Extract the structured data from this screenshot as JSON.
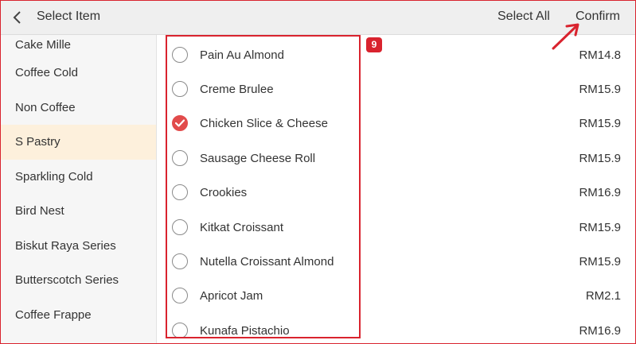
{
  "header": {
    "title": "Select Item",
    "select_all_label": "Select All",
    "confirm_label": "Confirm",
    "back_icon": "chevron-left-icon"
  },
  "sidebar": {
    "items": [
      {
        "label": "Cake Mille",
        "active": false
      },
      {
        "label": "Coffee Cold",
        "active": false
      },
      {
        "label": "Non Coffee",
        "active": false
      },
      {
        "label": "S Pastry",
        "active": true
      },
      {
        "label": "Sparkling Cold",
        "active": false
      },
      {
        "label": "Bird Nest",
        "active": false
      },
      {
        "label": "Biskut Raya Series",
        "active": false
      },
      {
        "label": "Butterscotch Series",
        "active": false
      },
      {
        "label": "Coffee Frappe",
        "active": false
      }
    ]
  },
  "items": [
    {
      "name": "Pain Au Almond",
      "price": "RM14.8",
      "checked": false
    },
    {
      "name": "Creme  Brulee",
      "price": "RM15.9",
      "checked": false
    },
    {
      "name": "Chicken Slice & Cheese",
      "price": "RM15.9",
      "checked": true
    },
    {
      "name": "Sausage Cheese Roll",
      "price": "RM15.9",
      "checked": false
    },
    {
      "name": "Crookies",
      "price": "RM16.9",
      "checked": false
    },
    {
      "name": "Kitkat Croissant",
      "price": "RM15.9",
      "checked": false
    },
    {
      "name": "Nutella Croissant Almond",
      "price": "RM15.9",
      "checked": false
    },
    {
      "name": "Apricot Jam",
      "price": "RM2.1",
      "checked": false
    },
    {
      "name": "Kunafa Pistachio",
      "price": "RM16.9",
      "checked": false
    }
  ],
  "annotation": {
    "badge": "9"
  },
  "colors": {
    "accent": "#e24b4b",
    "annotation": "#d9232e",
    "active_category": "#fdf0dc"
  }
}
